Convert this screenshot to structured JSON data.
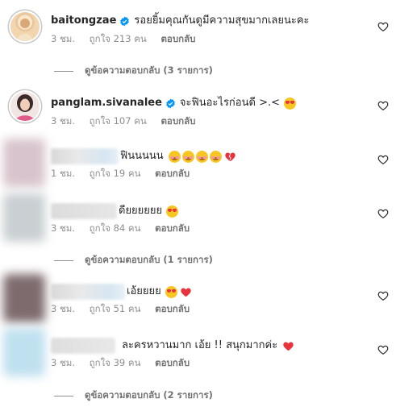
{
  "comments": [
    {
      "username": "baitongzae",
      "verified": true,
      "text": "รอยยิ้มคุณกันดูมีความสุขมากเลยนะคะ",
      "time": "3 ชม.",
      "likes": "ถูกใจ 213 คน",
      "reply_label": "ตอบกลับ",
      "view_replies": "ดูข้อความตอบกลับ (3 รายการ)"
    },
    {
      "username": "panglam.sivanalee",
      "verified": true,
      "text": "จะฟินอะไรก่อนดี >.<",
      "time": "3 ชม.",
      "likes": "ถูกใจ 107 คน",
      "reply_label": "ตอบกลับ"
    },
    {
      "username": "",
      "text": "ฟินนนนน",
      "time": "1 ชม.",
      "likes": "ถูกใจ 19 คน",
      "reply_label": "ตอบกลับ"
    },
    {
      "username": "",
      "text": "ดียยยยยย",
      "time": "3 ชม.",
      "likes": "ถูกใจ 84 คน",
      "reply_label": "ตอบกลับ",
      "view_replies": "ดูข้อความตอบกลับ (1 รายการ)"
    },
    {
      "username": "",
      "text": "เอ้ยยยย",
      "time": "3 ชม.",
      "likes": "ถูกใจ 51 คน",
      "reply_label": "ตอบกลับ"
    },
    {
      "username": "",
      "text": "ละครหวานมาก เอ้ย !! สนุกมากค่ะ",
      "time": "3 ชม.",
      "likes": "ถูกใจ 39 คน",
      "reply_label": "ตอบกลับ",
      "view_replies": "ดูข้อความตอบกลับ (2 รายการ)"
    }
  ],
  "icons": {
    "verified": "verified-badge-icon",
    "like": "heart-outline-icon"
  },
  "colors": {
    "verified": "#0095f6",
    "meta": "#8e8e8e",
    "heart_red": "#e8323c"
  }
}
